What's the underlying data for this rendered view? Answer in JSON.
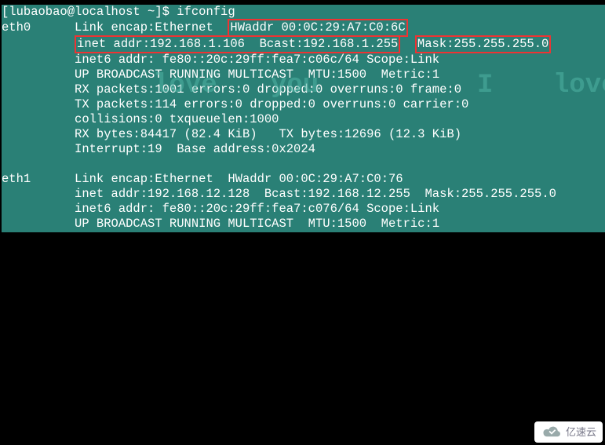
{
  "prompt": "[lubaobao@localhost ~]$ ",
  "command": "ifconfig",
  "eth0": {
    "name": "eth0",
    "link_encap_label": "Link encap:",
    "link_encap": "Ethernet",
    "hwaddr_label": "HWaddr ",
    "hwaddr": "00:0C:29:A7:C0:6C",
    "inet_addr_label": "inet addr:",
    "inet_addr": "192.168.1.106",
    "bcast_label": "Bcast:",
    "bcast": "192.168.1.255",
    "mask_label": "Mask:",
    "mask": "255.255.255.0",
    "inet6_line": "inet6 addr: fe80::20c:29ff:fea7:c06c/64 Scope:Link",
    "flags_line": "UP BROADCAST RUNNING MULTICAST  MTU:1500  Metric:1",
    "rx_packets": "RX packets:1001 errors:0 dropped:0 overruns:0 frame:0",
    "tx_packets": "TX packets:114 errors:0 dropped:0 overruns:0 carrier:0",
    "collisions": "collisions:0 txqueuelen:1000",
    "rx_bytes": "RX bytes:84417 (82.4 KiB)   TX bytes:12696 (12.3 KiB)",
    "interrupt": "Interrupt:19  Base address:0x2024"
  },
  "eth1": {
    "name": "eth1",
    "link_line": "Link encap:Ethernet  HWaddr 00:0C:29:A7:C0:76",
    "inet_line": "inet addr:192.168.12.128  Bcast:192.168.12.255  Mask:255.255.255.0",
    "inet6_line": "inet6 addr: fe80::20c:29ff:fea7:c076/64 Scope:Link",
    "flags_line": "UP BROADCAST RUNNING MULTICAST  MTU:1500  Metric:1"
  },
  "watermark": {
    "w1": "love",
    "w2": "you",
    "w3": "I",
    "w4": "love"
  },
  "badge_text": "亿速云"
}
